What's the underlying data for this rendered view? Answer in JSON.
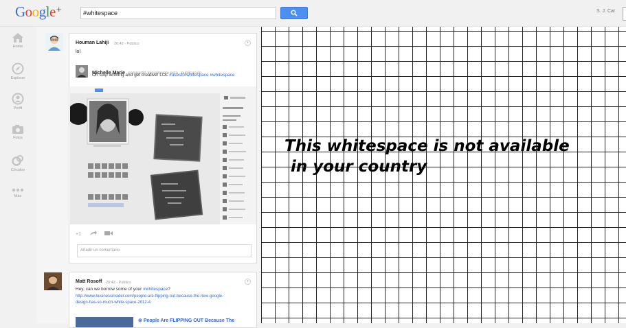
{
  "header": {
    "logo_text": "Google",
    "logo_plus": "+",
    "search_value": "#whitespace",
    "username": "S. J. Cat"
  },
  "nav": [
    {
      "label": "Home",
      "icon": "home-icon"
    },
    {
      "label": "Explorar",
      "icon": "compass-icon"
    },
    {
      "label": "Perfil",
      "icon": "profile-icon"
    },
    {
      "label": "Fotos",
      "icon": "camera-icon"
    },
    {
      "label": "Círculos",
      "icon": "circles-icon"
    },
    {
      "label": "Más",
      "icon": "more-icon"
    }
  ],
  "post1": {
    "author": "Houman Lahiji",
    "time": "20:42",
    "visibility": "Público",
    "text": "lol",
    "shared_author": "Michelle Marie",
    "shared_note": "compartió inicialmente esta",
    "shared_note_link": "publicación",
    "shared_text": "Oh stop whining and get creative! LOL",
    "shared_tag1": "#usesforwhitespace",
    "shared_tag2": "#whitespace",
    "plus_one": "+1",
    "comment_placeholder": "Añadir un comentario"
  },
  "post2": {
    "author": "Matt Rosoff",
    "time": "20:42",
    "visibility": "Público",
    "text": "Hey, can we borrow some of your",
    "text_tag": "#whitespace",
    "text_end": "?",
    "link_line1": "http://www.businessinsider.com/people-are-flipping-out-because-the-new-google-",
    "link_line2": "design-has-so-much-white-space-2012-4",
    "preview_title": "People Are FLIPPING OUT Because The"
  },
  "banner": {
    "line1": "This whitespace is not available",
    "line2": "in your country"
  },
  "colors": {
    "accent": "#4d8ff0",
    "link": "#3366cc",
    "grid_line": "#222222"
  }
}
